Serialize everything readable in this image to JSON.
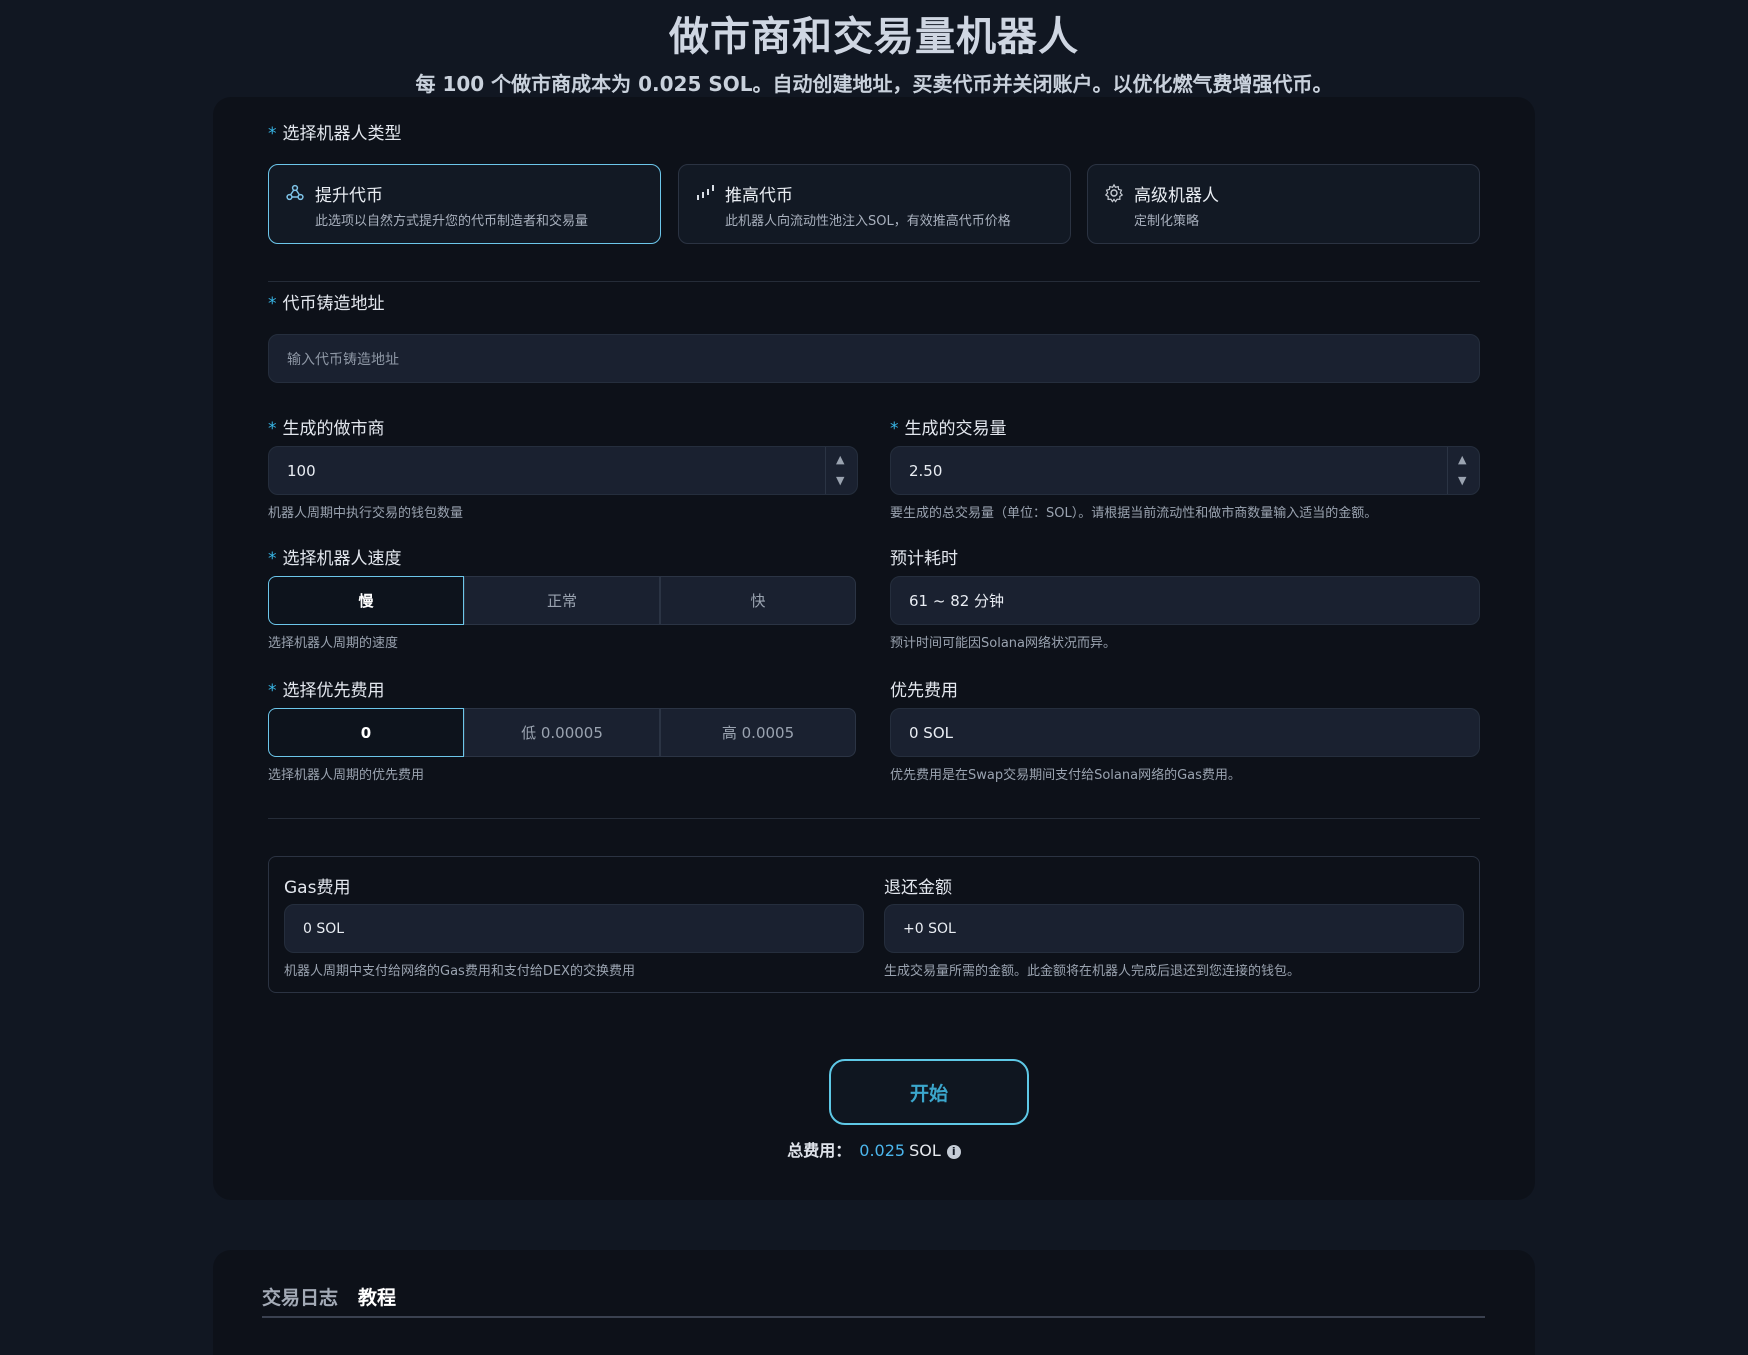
{
  "header": {
    "title": "做市商和交易量机器人",
    "subtitle": "每 100 个做市商成本为 0.025 SOL。自动创建地址，买卖代币并关闭账户。以优化燃气费增强代币。"
  },
  "bot_type": {
    "label": "选择机器人类型",
    "options": [
      {
        "title": "提升代币",
        "desc": "此选项以自然方式提升您的代币制造者和交易量",
        "icon": "network-icon",
        "selected": true
      },
      {
        "title": "推高代币",
        "desc": "此机器人向流动性池注入SOL，有效推高代币价格",
        "icon": "chart-up-icon",
        "selected": false
      },
      {
        "title": "高级机器人",
        "desc": "定制化策略",
        "icon": "gear-icon",
        "selected": false
      }
    ]
  },
  "mint": {
    "label": "代币铸造地址",
    "placeholder": "输入代币铸造地址"
  },
  "makers": {
    "label": "生成的做市商",
    "value": "100",
    "help": "机器人周期中执行交易的钱包数量"
  },
  "volume": {
    "label": "生成的交易量",
    "value": "2.50",
    "help": "要生成的总交易量（单位：SOL）。请根据当前流动性和做市商数量输入适当的金额。"
  },
  "speed": {
    "label": "选择机器人速度",
    "options": [
      "慢",
      "正常",
      "快"
    ],
    "selected": "慢",
    "help": "选择机器人周期的速度"
  },
  "eta": {
    "label": "预计耗时",
    "value": "61 ~ 82 分钟",
    "help": "预计时间可能因Solana网络状况而异。"
  },
  "priority": {
    "label": "选择优先费用",
    "options": [
      "0",
      "低 0.00005",
      "高 0.0005"
    ],
    "selected": "0",
    "help": "选择机器人周期的优先费用"
  },
  "priority_fee": {
    "label": "优先费用",
    "value": "0 SOL",
    "help": "优先费用是在Swap交易期间支付给Solana网络的Gas费用。"
  },
  "gas": {
    "label": "Gas费用",
    "value": "0 SOL",
    "help": "机器人周期中支付给网络的Gas费用和支付给DEX的交换费用"
  },
  "refund": {
    "label": "退还金额",
    "value": "+0 SOL",
    "help": "生成交易量所需的金额。此金额将在机器人完成后退还到您连接的钱包。"
  },
  "start_button": "开始",
  "total": {
    "label": "总费用：",
    "value": "0.025",
    "unit": "SOL",
    "info_icon": "i"
  },
  "bottom_tabs": [
    {
      "label": "交易日志",
      "active": false
    },
    {
      "label": "教程",
      "active": true
    }
  ],
  "colors": {
    "accent": "#38b6e6",
    "background": "#111722",
    "card": "#0d1119"
  }
}
